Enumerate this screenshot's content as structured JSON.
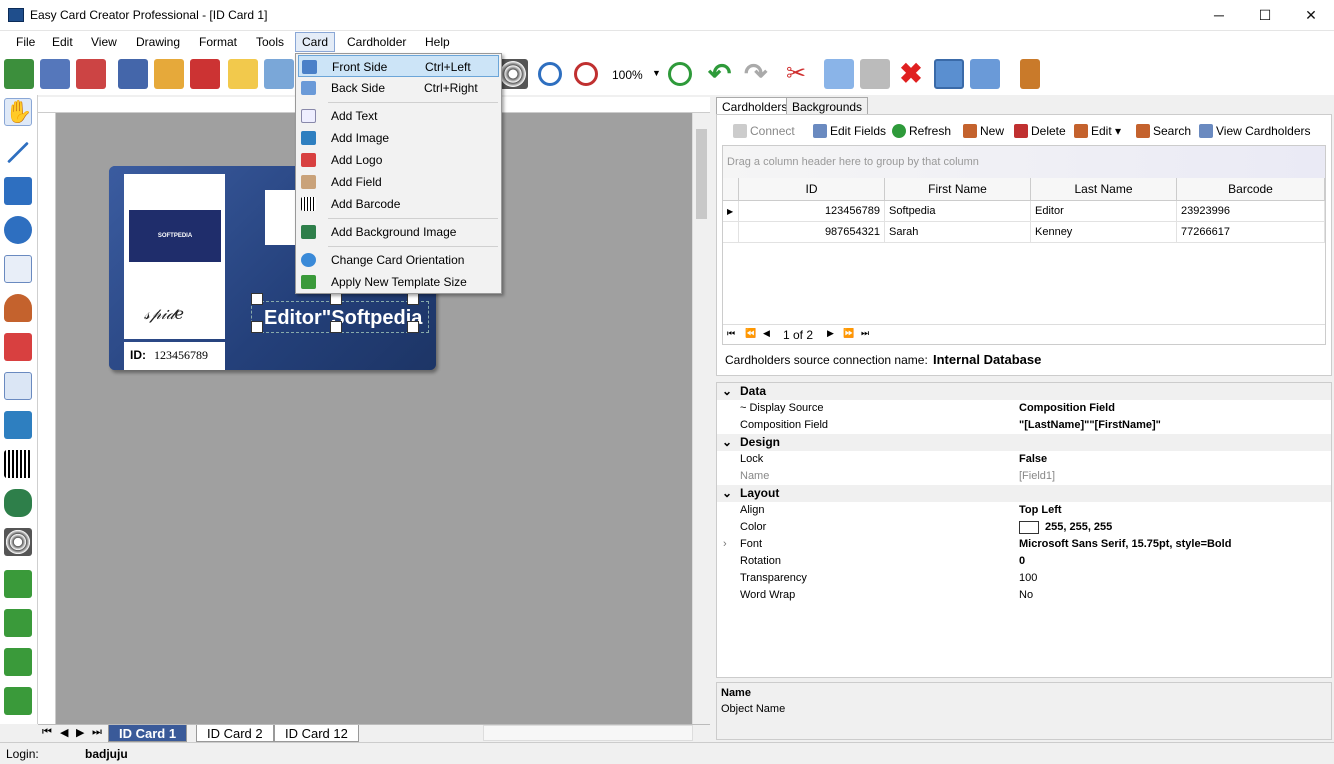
{
  "window": {
    "title": "Easy Card Creator Professional - [ID Card 1]",
    "minimize": "─",
    "maximize": "☐",
    "close": "✕"
  },
  "menu": [
    "File",
    "Edit",
    "View",
    "Drawing",
    "Format",
    "Tools",
    "Card",
    "Cardholder",
    "Help"
  ],
  "toolbar": {
    "zoom": "100%"
  },
  "card_dropdown": {
    "front_side": "Front Side",
    "front_side_sc": "Ctrl+Left",
    "back_side": "Back Side",
    "back_side_sc": "Ctrl+Right",
    "add_text": "Add Text",
    "add_image": "Add Image",
    "add_logo": "Add Logo",
    "add_field": "Add Field",
    "add_barcode": "Add Barcode",
    "add_bg_image": "Add Background Image",
    "change_orientation": "Change Card Orientation",
    "apply_template": "Apply New Template Size"
  },
  "card": {
    "logo_text": "SOFTPEDIA",
    "signature": "𝓈𝓅𝒾𝒹𝑒",
    "id_label": "ID:",
    "id_value": "123456789",
    "field_text": "Editor\"Softpedia"
  },
  "tabs": [
    "ID Card 1",
    "ID Card 2",
    "ID Card 12"
  ],
  "status": {
    "login_label": "Login:",
    "login_value": "badjuju"
  },
  "right_tabs": {
    "cardholders": "Cardholders",
    "backgrounds": "Backgrounds"
  },
  "ch_toolbar": {
    "connect": "Connect",
    "edit_fields": "Edit Fields",
    "refresh": "Refresh",
    "new": "New",
    "delete": "Delete",
    "edit": "Edit",
    "search": "Search",
    "view": "View Cardholders"
  },
  "grid": {
    "group_hint": "Drag a column header here to group by that column",
    "columns": [
      "ID",
      "First Name",
      "Last Name",
      "Barcode"
    ],
    "rows": [
      [
        "123456789",
        "Softpedia",
        "Editor",
        "23923996"
      ],
      [
        "987654321",
        "Sarah",
        "Kenney",
        "77266617"
      ]
    ],
    "pager": "1 of 2"
  },
  "source": {
    "label": "Cardholders source connection name:",
    "value": "Internal Database"
  },
  "props": {
    "data": "Data",
    "display_source_k": "~ Display Source",
    "display_source_v": "Composition Field",
    "comp_field_k": "Composition Field",
    "comp_field_v": "\"[LastName]\"\"[FirstName]\"",
    "design": "Design",
    "lock_k": "Lock",
    "lock_v": "False",
    "name_k": "Name",
    "name_v": "[Field1]",
    "layout": "Layout",
    "align_k": "Align",
    "align_v": "Top Left",
    "color_k": "Color",
    "color_v": "255, 255, 255",
    "font_k": "Font",
    "font_v": "Microsoft Sans Serif, 15.75pt, style=Bold",
    "rotation_k": "Rotation",
    "rotation_v": "0",
    "transparency_k": "Transparency",
    "transparency_v": "100",
    "wordwrap_k": "Word Wrap",
    "wordwrap_v": "No"
  },
  "desc": {
    "title": "Name",
    "text": "Object Name"
  },
  "colors": {
    "accent": "#3a5a99",
    "card_bg": "#2c4a86",
    "menu_hl": "#cce4f7"
  }
}
